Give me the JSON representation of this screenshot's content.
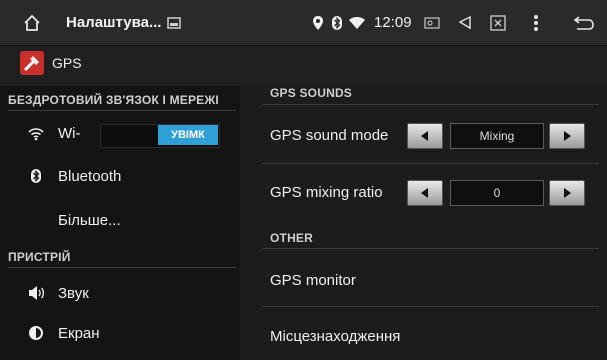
{
  "status_bar": {
    "title": "Налаштува...",
    "time": "12:09"
  },
  "app_bar": {
    "title": "GPS"
  },
  "left_panel": {
    "section_wireless": "БЕЗДРОТОВИЙ ЗВ'ЯЗОК І МЕРЕЖІ",
    "wifi_label": "Wi-",
    "wifi_toggle": "УВІМК",
    "bluetooth_label": "Bluetooth",
    "more_label": "Більше...",
    "section_device": "ПРИСТРІЙ",
    "sound_label": "Звук",
    "screen_label": "Екран"
  },
  "right_panel": {
    "section_gps_sounds": "GPS SOUNDS",
    "sound_mode_label": "GPS sound mode",
    "sound_mode_value": "Mixing",
    "mixing_ratio_label": "GPS mixing ratio",
    "mixing_ratio_value": "0",
    "section_other": "OTHER",
    "gps_monitor_label": "GPS monitor",
    "location_label": "Місцезнаходження"
  },
  "colors": {
    "accent": "#2f9fd8",
    "app_icon": "#c9302c"
  }
}
